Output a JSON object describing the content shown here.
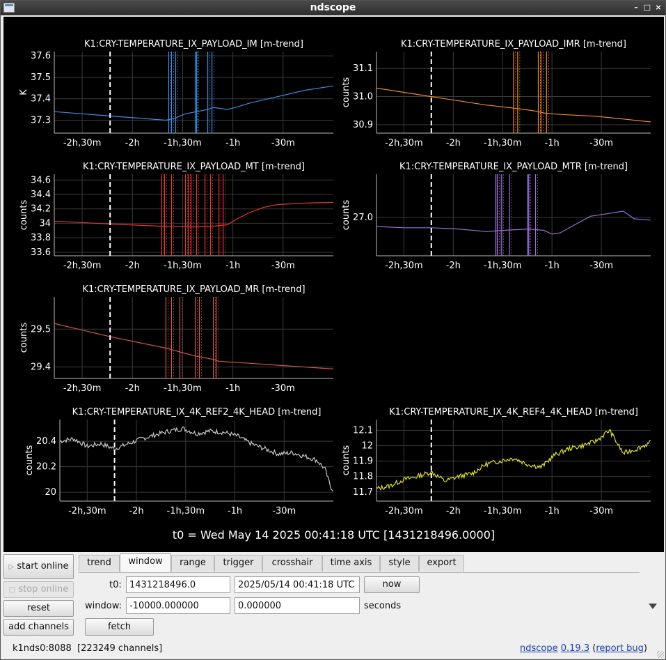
{
  "window": {
    "title": "ndscope"
  },
  "t0_banner": "t0 = Wed May 14 2025 00:41:18 UTC [1431218496.0000]",
  "colors": {
    "background": "#000000",
    "grid": "#3a3a3a",
    "cursor_line": "#ffffff"
  },
  "chart_data": [
    {
      "type": "line",
      "title": "K1:CRY-TEMPERATURE_IX_PAYLOAD_IM [m-trend]",
      "ylabel": "K",
      "color": "#3d8fe0",
      "xlim": [
        -10000,
        0
      ],
      "ylim": [
        37.24,
        37.62
      ],
      "yticks": [
        37.3,
        37.4,
        37.5,
        37.6
      ],
      "ytick_labels": [
        "37.3",
        "37.4",
        "37.5",
        "37.6"
      ],
      "xticks": [
        -9000,
        -7200,
        -5400,
        -3600,
        -1800
      ],
      "xtick_labels": [
        "-2h,30m",
        "-2h",
        "-1h,30m",
        "-1h",
        "-30m"
      ],
      "cursor_x": -8000,
      "x": [
        -10000,
        -8000,
        -6000,
        -5650,
        -5500,
        -5300,
        -4500,
        -4300,
        -3800,
        -3500,
        -3000,
        -2000,
        -1000,
        0
      ],
      "y": [
        37.34,
        37.32,
        37.3,
        37.31,
        37.32,
        37.33,
        37.35,
        37.36,
        37.35,
        37.36,
        37.38,
        37.41,
        37.44,
        37.46
      ],
      "spikes": [
        -5900,
        -5800,
        -5650,
        -4950,
        -4900,
        -4500,
        -4350
      ]
    },
    {
      "type": "line",
      "title": "K1:CRY-TEMPERATURE_IX_PAYLOAD_IMR [m-trend]",
      "ylabel": "counts",
      "color": "#f08c2a",
      "xlim": [
        -10000,
        0
      ],
      "ylim": [
        30.87,
        31.16
      ],
      "yticks": [
        30.9,
        31.0,
        31.1
      ],
      "ytick_labels": [
        "30.9",
        "31.0",
        "31.1"
      ],
      "xticks": [
        -9000,
        -7200,
        -5400,
        -3600,
        -1800
      ],
      "xtick_labels": [
        "-2h,30m",
        "-2h",
        "-1h,30m",
        "-1h",
        "-30m"
      ],
      "cursor_x": -8000,
      "x": [
        -10000,
        -8000,
        -6000,
        -5100,
        -4300,
        -3800,
        -3000,
        -2000,
        -1000,
        0
      ],
      "y": [
        31.03,
        31.0,
        30.97,
        30.96,
        30.95,
        30.94,
        30.935,
        30.93,
        30.92,
        30.91
      ],
      "spikes": [
        -5000,
        -4850,
        -4100,
        -4000,
        -3800
      ]
    },
    {
      "type": "line",
      "title": "K1:CRY-TEMPERATURE_IX_PAYLOAD_MT [m-trend]",
      "ylabel": "counts",
      "color": "#e0392e",
      "xlim": [
        -10000,
        0
      ],
      "ylim": [
        33.55,
        34.68
      ],
      "yticks": [
        33.6,
        33.8,
        34.0,
        34.2,
        34.4,
        34.6
      ],
      "ytick_labels": [
        "33.6",
        "33.8",
        "34",
        "34.2",
        "34.4",
        "34.6"
      ],
      "xticks": [
        -9000,
        -7200,
        -5400,
        -3600,
        -1800
      ],
      "xtick_labels": [
        "-2h,30m",
        "-2h",
        "-1h,30m",
        "-1h",
        "-30m"
      ],
      "cursor_x": -8000,
      "x": [
        -10000,
        -8000,
        -6200,
        -5000,
        -4300,
        -3800,
        -3500,
        -3000,
        -2500,
        -2000,
        -1000,
        0
      ],
      "y": [
        34.03,
        33.99,
        33.96,
        33.95,
        33.96,
        33.98,
        34.05,
        34.15,
        34.22,
        34.26,
        34.28,
        34.29
      ],
      "spikes": [
        -6150,
        -6050,
        -5800,
        -5300,
        -5200,
        -5100,
        -4900,
        -4600,
        -4400,
        -4100,
        -3950
      ]
    },
    {
      "type": "line",
      "title": "K1:CRY-TEMPERATURE_IX_PAYLOAD_MTR [m-trend]",
      "ylabel": "counts",
      "color": "#9b6fd6",
      "xlim": [
        -10000,
        0
      ],
      "ylim": [
        26.85,
        27.17
      ],
      "yticks": [
        27.0
      ],
      "ytick_labels": [
        "27.0"
      ],
      "xticks": [
        -9000,
        -7200,
        -5400,
        -3600,
        -1800
      ],
      "xtick_labels": [
        "-2h,30m",
        "-2h",
        "-1h,30m",
        "-1h",
        "-30m"
      ],
      "cursor_x": -8000,
      "x": [
        -10000,
        -9000,
        -8000,
        -7000,
        -6000,
        -5300,
        -4500,
        -3900,
        -3600,
        -3300,
        -2800,
        -2200,
        -1600,
        -1000,
        -600,
        0
      ],
      "y": [
        26.965,
        26.96,
        26.96,
        26.955,
        26.945,
        26.95,
        26.955,
        26.95,
        26.935,
        26.94,
        26.97,
        27.005,
        27.015,
        27.025,
        26.995,
        26.99
      ],
      "spikes": [
        -5650,
        -5600,
        -5450,
        -5150,
        -4500,
        -4450,
        -4200
      ]
    },
    {
      "type": "line",
      "title": "K1:CRY-TEMPERATURE_IX_PAYLOAD_MR [m-trend]",
      "ylabel": "counts",
      "color": "#d0574a",
      "xlim": [
        -10000,
        0
      ],
      "ylim": [
        29.37,
        29.585
      ],
      "yticks": [
        29.4,
        29.5
      ],
      "ytick_labels": [
        "29.4",
        "29.5"
      ],
      "xticks": [
        -9000,
        -7200,
        -5400,
        -3600,
        -1800
      ],
      "xtick_labels": [
        "-2h,30m",
        "-2h",
        "-1h,30m",
        "-1h",
        "-30m"
      ],
      "cursor_x": -8000,
      "x": [
        -10000,
        -8000,
        -6000,
        -5000,
        -4300,
        -4100,
        -3000,
        -2000,
        -1000,
        0
      ],
      "y": [
        29.515,
        29.48,
        29.45,
        29.43,
        29.42,
        29.415,
        29.41,
        29.405,
        29.4,
        29.395
      ],
      "spikes": [
        -6000,
        -5800,
        -5500,
        -4950,
        -4800,
        -4300,
        -4200
      ]
    },
    {
      "type": "line",
      "title": "K1:CRY-TEMPERATURE_IX_4K_REF2_4K_HEAD [m-trend]",
      "ylabel": "counts",
      "color": "#c8c8c8",
      "xlim": [
        -10000,
        0
      ],
      "ylim": [
        19.93,
        20.57
      ],
      "yticks": [
        20.0,
        20.2,
        20.4
      ],
      "ytick_labels": [
        "20",
        "20.2",
        "20.4"
      ],
      "xticks": [
        -9000,
        -7200,
        -5400,
        -3600,
        -1800
      ],
      "xtick_labels": [
        "-2h,30m",
        "-2h",
        "-1h,30m",
        "-1h",
        "-30m"
      ],
      "cursor_x": -8000,
      "x": [
        -10000,
        -9500,
        -9000,
        -8500,
        -8000,
        -7500,
        -7000,
        -6500,
        -6000,
        -5500,
        -5000,
        -4500,
        -4000,
        -3500,
        -3000,
        -2500,
        -2000,
        -1500,
        -1000,
        -600,
        -300,
        -100,
        0
      ],
      "y": [
        20.4,
        20.42,
        20.36,
        20.38,
        20.34,
        20.38,
        20.42,
        20.45,
        20.48,
        20.5,
        20.46,
        20.48,
        20.47,
        20.44,
        20.38,
        20.34,
        20.3,
        20.31,
        20.28,
        20.25,
        20.18,
        20.04,
        20.02
      ],
      "noise_seed": 7
    },
    {
      "type": "line",
      "title": "K1:CRY-TEMPERATURE_IX_4K_REF4_4K_HEAD [m-trend]",
      "ylabel": "counts",
      "color": "#e3e02e",
      "xlim": [
        -10000,
        0
      ],
      "ylim": [
        11.64,
        12.17
      ],
      "yticks": [
        11.7,
        11.8,
        11.9,
        12.0,
        12.1
      ],
      "ytick_labels": [
        "11.7",
        "11.8",
        "11.9",
        "12",
        "12.1"
      ],
      "xticks": [
        -9000,
        -7200,
        -5400,
        -3600,
        -1800
      ],
      "xtick_labels": [
        "-2h,30m",
        "-2h",
        "-1h,30m",
        "-1h",
        "-30m"
      ],
      "cursor_x": -8000,
      "x": [
        -10000,
        -9500,
        -9000,
        -8500,
        -8000,
        -7500,
        -7000,
        -6500,
        -6000,
        -5500,
        -5000,
        -4500,
        -4000,
        -3500,
        -3000,
        -2500,
        -2000,
        -1500,
        -1000,
        -500,
        0
      ],
      "y": [
        11.72,
        11.74,
        11.78,
        11.8,
        11.83,
        11.77,
        11.8,
        11.82,
        11.88,
        11.9,
        11.92,
        11.88,
        11.86,
        11.94,
        11.98,
        12.0,
        12.03,
        12.1,
        11.95,
        11.98,
        12.02
      ],
      "noise_seed": 13
    }
  ],
  "controls": {
    "start_online": "start online",
    "stop_online": "stop online",
    "reset": "reset",
    "add_channels": "add channels",
    "tabs": [
      "trend",
      "window",
      "range",
      "trigger",
      "crosshair",
      "time axis",
      "style",
      "export"
    ],
    "active_tab": "window",
    "t0_label": "t0:",
    "t0_gps": "1431218496.0",
    "t0_utc": "2025/05/14 00:41:18 UTC",
    "now_button": "now",
    "window_label": "window:",
    "window_start": "-10000.000000",
    "window_end": "0.000000",
    "seconds_label": "seconds",
    "fetch_button": "fetch"
  },
  "status": {
    "server": "k1nds0:8088",
    "channels": "[223249 channels]",
    "app_link": "ndscope",
    "version_link": "0.19.3",
    "report_open": "(",
    "report_link": "report bug",
    "report_close": ")"
  }
}
